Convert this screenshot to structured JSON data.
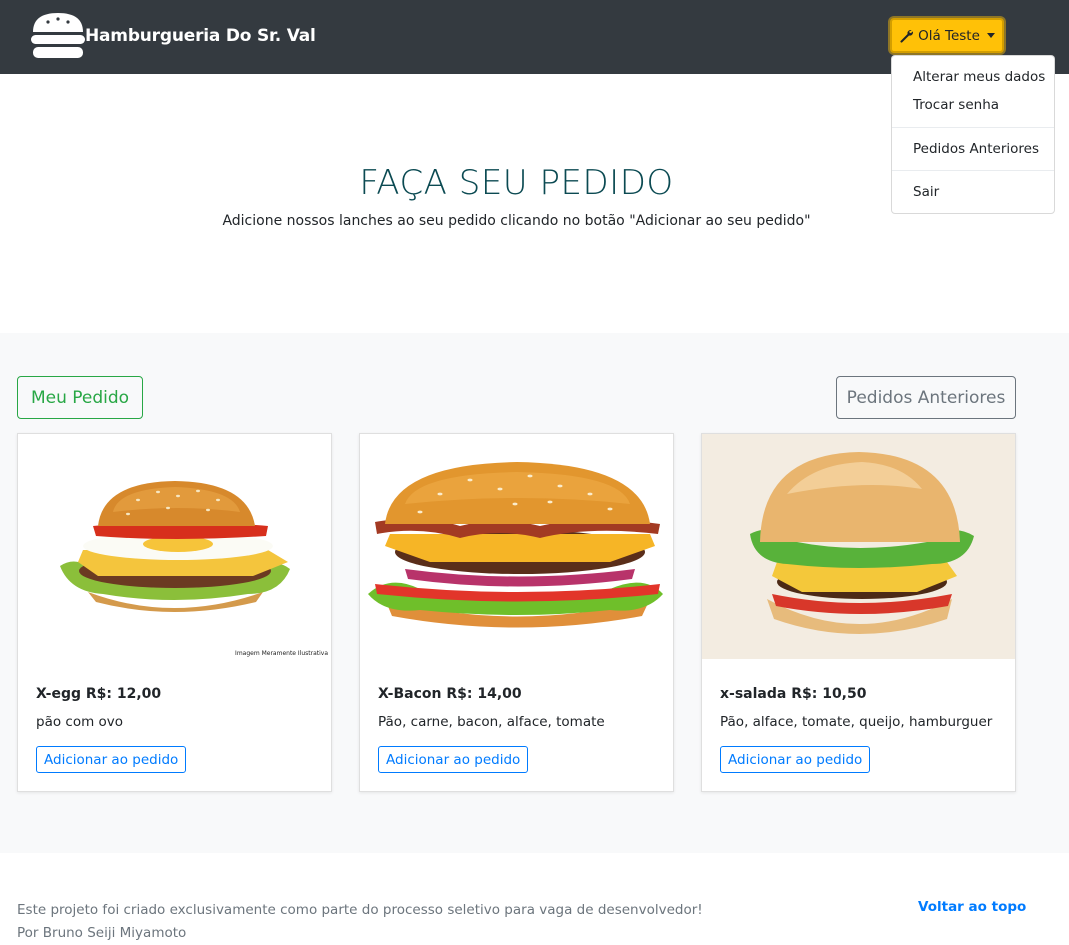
{
  "navbar": {
    "brand": "Hamburgueria Do Sr. Val",
    "user_button": "Olá Teste",
    "logo_icon": "burger-icon",
    "user_icon": "wrench-icon"
  },
  "dropdown": {
    "items": [
      "Alterar meus dados",
      "Trocar senha",
      "Pedidos Anteriores",
      "Sair"
    ]
  },
  "hero": {
    "title": "FAÇA SEU PEDIDO",
    "subtitle": "Adicione nossos lanches ao seu pedido clicando no botão \"Adicionar ao seu pedido\""
  },
  "actions": {
    "my_order": "Meu Pedido",
    "previous_orders": "Pedidos Anteriores"
  },
  "products": [
    {
      "title": "X-egg R$: 12,00",
      "description": "pão com ovo",
      "button": "Adicionar ao pedido",
      "image_caption": "Imagem Meramente Ilustrativa"
    },
    {
      "title": "X-Bacon R$: 14,00",
      "description": "Pão, carne, bacon, alface, tomate",
      "button": "Adicionar ao pedido"
    },
    {
      "title": "x-salada R$: 10,50",
      "description": "Pão, alface, tomate, queijo, hamburguer",
      "button": "Adicionar ao pedido"
    }
  ],
  "footer": {
    "line1": "Este projeto foi criado exclusivamente como parte do processo seletivo para vaga de desenvolvedor!",
    "line2": "Por Bruno Seiji Miyamoto",
    "back_to_top": "Voltar ao topo"
  },
  "colors": {
    "navbar": "#343a40",
    "warning": "#ffc107",
    "success": "#28a745",
    "primary": "#007bff",
    "secondary": "#6c757d"
  }
}
